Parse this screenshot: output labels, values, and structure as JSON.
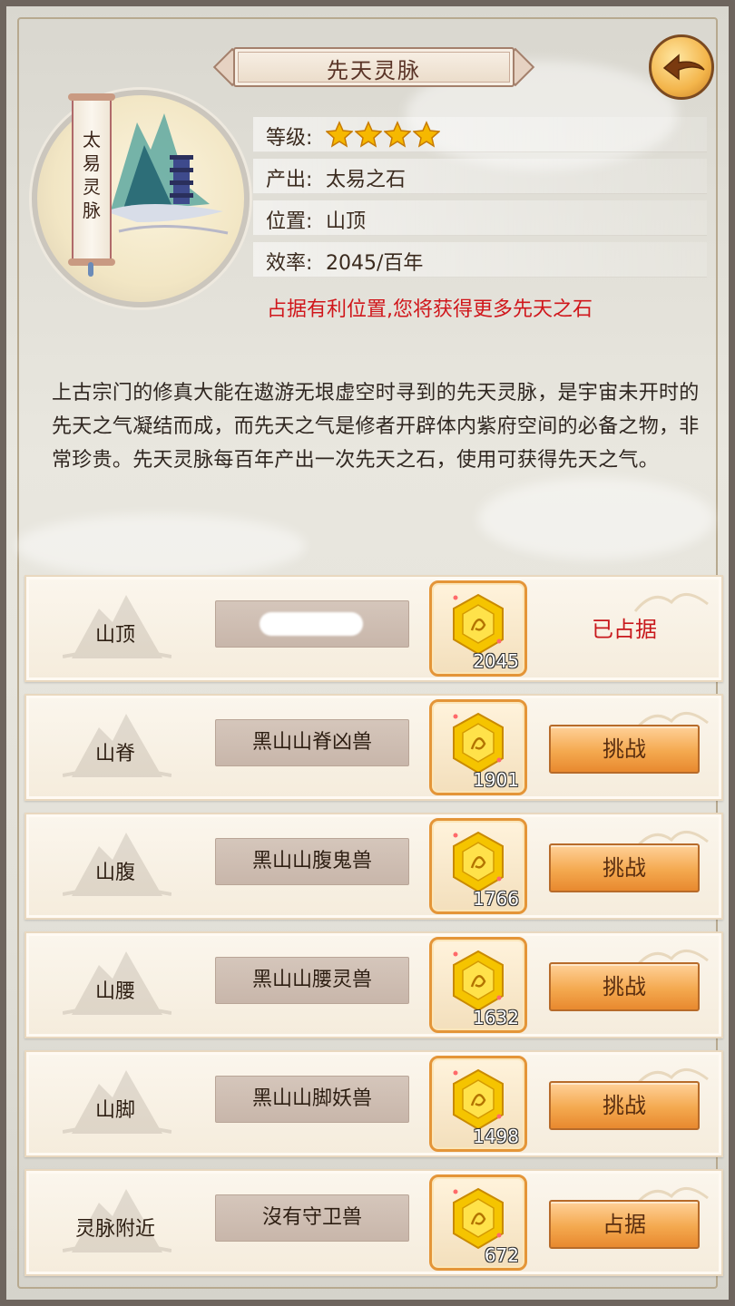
{
  "header": {
    "title": "先天灵脉"
  },
  "emblem": {
    "scroll_text": [
      "太",
      "易",
      "灵",
      "脉"
    ]
  },
  "info": {
    "level_label": "等级:",
    "level_stars": 4,
    "output_label": "产出:",
    "output_value": "太易之石",
    "location_label": "位置:",
    "location_value": "山顶",
    "efficiency_label": "效率:",
    "efficiency_value": "2045/百年",
    "warning": "占据有利位置,您将获得更多先天之石"
  },
  "description": "上古宗门的修真大能在遨游无垠虚空时寻到的先天灵脉，是宇宙未开时的先天之气凝结而成，而先天之气是修者开辟体内紫府空间的必备之物，非常珍贵。先天灵脉每百年产出一次先天之石，使用可获得先天之气。",
  "rows": [
    {
      "position": "山顶",
      "guard": "",
      "gems": "2045",
      "status": "已占据",
      "action": ""
    },
    {
      "position": "山脊",
      "guard": "黑山山脊凶兽",
      "gems": "1901",
      "status": "",
      "action": "挑战"
    },
    {
      "position": "山腹",
      "guard": "黑山山腹鬼兽",
      "gems": "1766",
      "status": "",
      "action": "挑战"
    },
    {
      "position": "山腰",
      "guard": "黑山山腰灵兽",
      "gems": "1632",
      "status": "",
      "action": "挑战"
    },
    {
      "position": "山脚",
      "guard": "黑山山脚妖兽",
      "gems": "1498",
      "status": "",
      "action": "挑战"
    },
    {
      "position": "灵脉附近",
      "guard": "沒有守卫兽",
      "gems": "672",
      "status": "",
      "action": "占据"
    }
  ],
  "icons": {
    "back": "back-arrow-icon",
    "star": "star-icon",
    "gem": "gem-icon"
  },
  "colors": {
    "accent": "#f4a94f",
    "warning": "#d0161b",
    "title": "#5a3427"
  }
}
